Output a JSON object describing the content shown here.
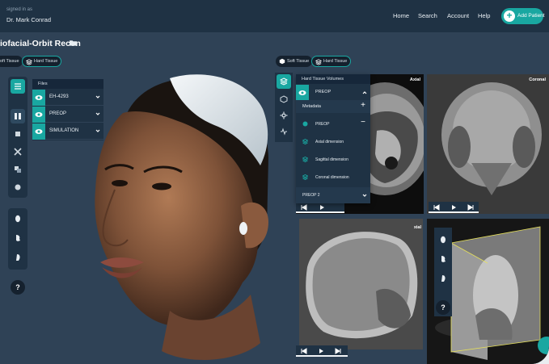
{
  "user": {
    "signed_in_label": "signed in as",
    "name": "Dr. Mark Conrad"
  },
  "nav": {
    "home": "Home",
    "search": "Search",
    "account": "Account",
    "help": "Help",
    "add_patient": "Add Patient"
  },
  "page": {
    "title": "iofacial-Orbit Recon"
  },
  "left_toggles": {
    "soft": "oft Tissue",
    "hard": "Hard Tissue"
  },
  "right_toggles": {
    "soft": "Soft Tissue",
    "hard": "Hard Tissue"
  },
  "files": {
    "header": "Files",
    "items": [
      {
        "label": "EH-4293"
      },
      {
        "label": "PREOP"
      },
      {
        "label": "SIMULATION"
      }
    ]
  },
  "volumes": {
    "header": "Hard Tissue Volumes",
    "active": "PREOP",
    "metadata_label": "Metadata",
    "group_label": "PREOP",
    "dimensions": [
      {
        "label": "Axial dimension"
      },
      {
        "label": "Sagittal dimension"
      },
      {
        "label": "Coronal dimension"
      }
    ],
    "other": "PREOP 2"
  },
  "viewports": {
    "axial": "Axial",
    "coronal": "Coronal",
    "sagittal_partial": "xial"
  },
  "help_glyph": "?",
  "colors": {
    "accent": "#19a7a1",
    "background": "#2f4256",
    "panel": "#1f3244"
  }
}
